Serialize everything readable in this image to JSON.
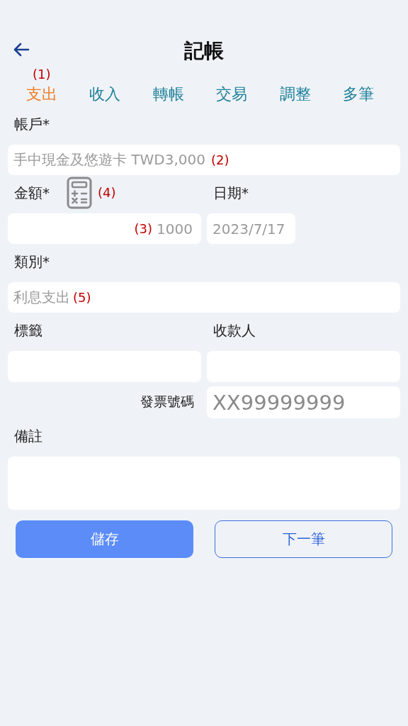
{
  "header": {
    "title": "記帳"
  },
  "tabs": [
    {
      "label": "支出",
      "selected": true,
      "marker": "(1)"
    },
    {
      "label": "收入",
      "selected": false
    },
    {
      "label": "轉帳",
      "selected": false
    },
    {
      "label": "交易",
      "selected": false
    },
    {
      "label": "調整",
      "selected": false
    },
    {
      "label": "多筆",
      "selected": false
    }
  ],
  "account": {
    "label": "帳戶*",
    "placeholder": "手中現金及悠遊卡 TWD3,000",
    "marker": "(2)"
  },
  "amount": {
    "label": "金額*",
    "placeholder": "1000",
    "marker": "(3)",
    "calculator_marker": "(4)"
  },
  "date": {
    "label": "日期*",
    "placeholder": "2023/7/17"
  },
  "category": {
    "label": "類別*",
    "placeholder": "利息支出",
    "marker": "(5)"
  },
  "tag": {
    "label": "標籤"
  },
  "payee": {
    "label": "收款人"
  },
  "invoice": {
    "label": "發票號碼",
    "placeholder": "XX99999999"
  },
  "note": {
    "label": "備註"
  },
  "buttons": [
    {
      "label": "儲存",
      "kind": "primary"
    },
    {
      "label": "下一筆",
      "kind": "secondary"
    }
  ]
}
